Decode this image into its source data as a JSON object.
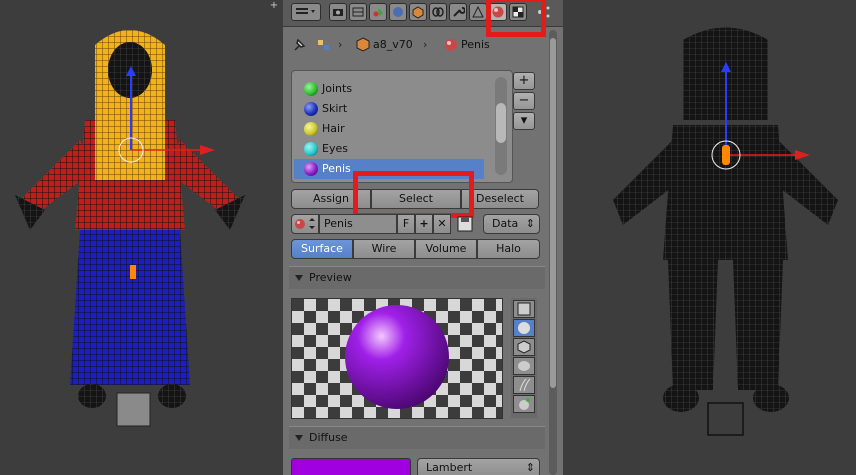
{
  "header": {
    "tabs": [
      "render-icon",
      "render-layers-icon",
      "scene-icon",
      "world-icon",
      "object-icon",
      "constraints-icon",
      "modifiers-icon",
      "data-icon",
      "material-icon",
      "texture-icon"
    ],
    "active_tab": "material-icon"
  },
  "breadcrumb": {
    "object_name": "a8_v70",
    "material_name": "Penis"
  },
  "material_slots": {
    "items": [
      {
        "label": "Joints",
        "color": "#2fbf2f"
      },
      {
        "label": "Skirt",
        "color": "#1d2fbf"
      },
      {
        "label": "Hair",
        "color": "#c9c92a"
      },
      {
        "label": "Eyes",
        "color": "#2ac9c9"
      },
      {
        "label": "Penis",
        "color": "#8a1cc9"
      }
    ],
    "selected_index": 4,
    "add_label": "+",
    "remove_label": "−",
    "menu_label": "▾"
  },
  "slot_buttons": {
    "assign": "Assign",
    "select": "Select",
    "deselect": "Deselect"
  },
  "material_selector": {
    "name": "Penis",
    "fake_user": "F",
    "add_icon": "+",
    "unlink_icon": "✕",
    "link_type": "Data"
  },
  "type_tabs": {
    "items": [
      "Surface",
      "Wire",
      "Volume",
      "Halo"
    ],
    "active": "Surface"
  },
  "preview": {
    "title": "Preview",
    "ball_color": "#8c10d8",
    "shapes": [
      "flat-icon",
      "sphere-icon",
      "cube-icon",
      "monkey-icon",
      "hair-icon",
      "sky-sphere-icon"
    ],
    "active_shape": "sphere-icon"
  },
  "diffuse": {
    "title": "Diffuse",
    "color": "#a000e0",
    "shader": "Lambert"
  },
  "highlight_color": "#e21b1b"
}
